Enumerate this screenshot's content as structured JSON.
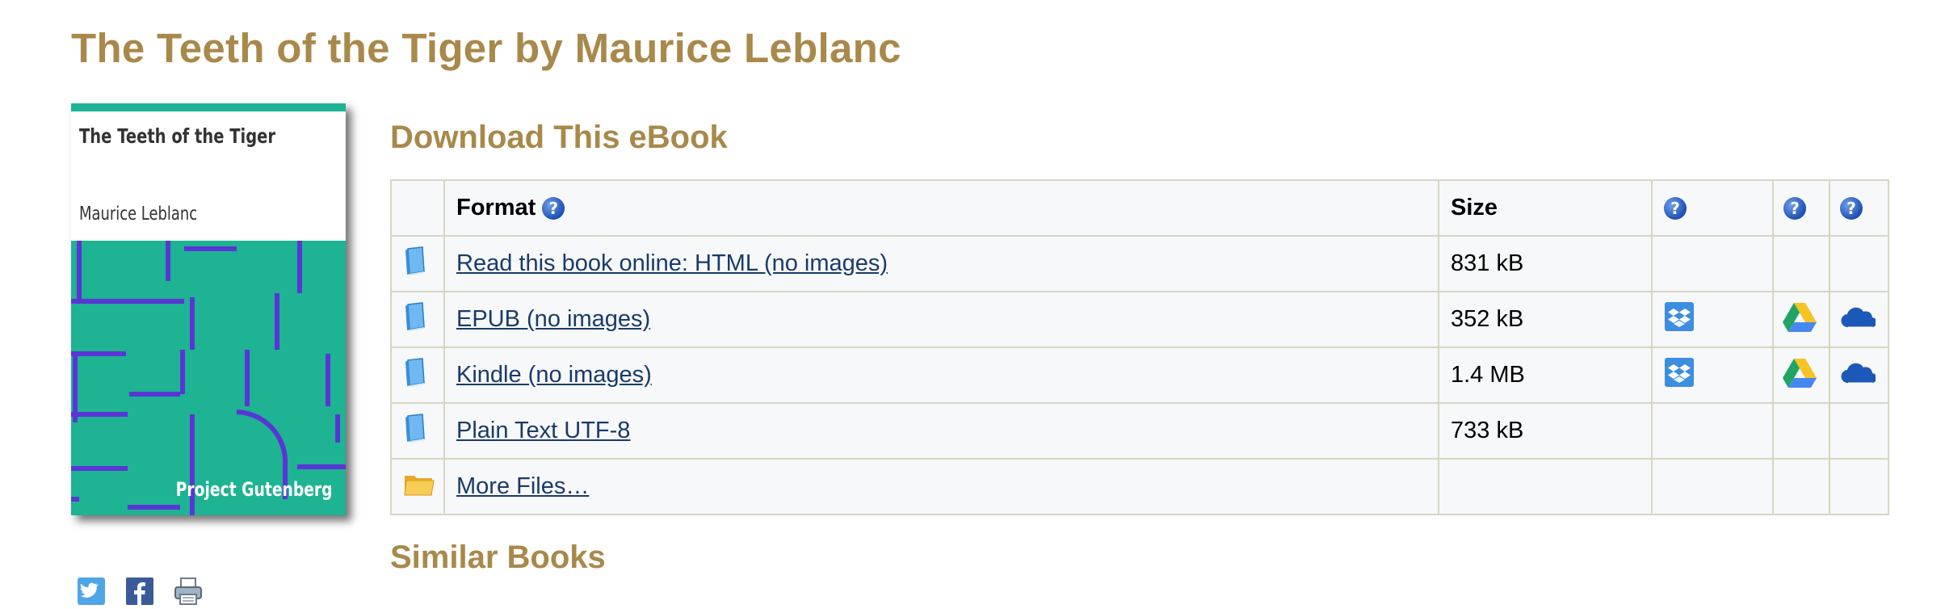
{
  "page": {
    "title": "The Teeth of the Tiger by Maurice Leblanc"
  },
  "cover": {
    "title": "The Teeth of the Tiger",
    "author": "Maurice Leblanc",
    "publisher": "Project Gutenberg",
    "colors": {
      "art_bg": "#1eb392",
      "lines": "#5a35d6"
    }
  },
  "social": [
    {
      "name": "twitter-icon"
    },
    {
      "name": "facebook-icon"
    },
    {
      "name": "print-icon"
    }
  ],
  "download": {
    "heading": "Download This eBook",
    "columns": {
      "format": "Format",
      "size": "Size",
      "help_glyph": "?"
    },
    "rows": [
      {
        "label": "Read this book online: HTML (no images)",
        "size": "831 kB",
        "icon": "ebook-icon",
        "services": false
      },
      {
        "label": "EPUB (no images)",
        "size": "352 kB",
        "icon": "ebook-icon",
        "services": true
      },
      {
        "label": "Kindle (no images)",
        "size": "1.4 MB",
        "icon": "ebook-icon",
        "services": true
      },
      {
        "label": "Plain Text UTF-8",
        "size": "733 kB",
        "icon": "ebook-icon",
        "services": false
      },
      {
        "label": "More Files…",
        "size": "",
        "icon": "folder-icon",
        "services": false
      }
    ]
  },
  "similar": {
    "heading": "Similar Books"
  },
  "colors": {
    "heading": "#a8894a",
    "link": "#1a3a6b",
    "table_border": "#d7d7c2",
    "table_bg": "#f7f8f9"
  }
}
